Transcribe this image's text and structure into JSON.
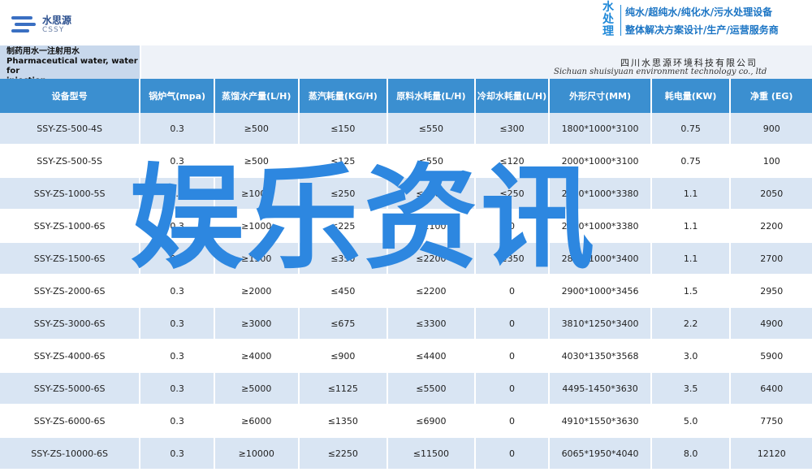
{
  "header": {
    "logo_cn": "水思源",
    "logo_en": "CSSY",
    "brand_vertical": "水处理",
    "tagline_1": "纯水/超纯水/纯化水/污水处理设备",
    "tagline_2": "整体解决方案设计/生产/运营服务商"
  },
  "subheader": {
    "title_cn": "制药用水一注射用水",
    "title_en_1": "Pharmaceutical water, water for",
    "title_en_2": "injection",
    "company_cn": "四川水思源环境科技有限公司",
    "company_en": "Sichuan shuisiyuan environment technology co., ltd"
  },
  "table": {
    "columns": [
      "设备型号",
      "锅炉气(mpa)",
      "蒸馏水产量(L/H)",
      "蒸汽耗量(KG/H)",
      "原料水耗量(L/H)",
      "冷却水耗量(L/H)",
      "外形尺寸(MM)",
      "耗电量(KW)",
      "净重 (EG)"
    ],
    "rows": [
      [
        "SSY-ZS-500-4S",
        "0.3",
        "≥500",
        "≤150",
        "≤550",
        "≤300",
        "1800*1000*3100",
        "0.75",
        "900"
      ],
      [
        "SSY-ZS-500-5S",
        "0.3",
        "≥500",
        "≤125",
        "≤550",
        "≤120",
        "2000*1000*3100",
        "0.75",
        "100"
      ],
      [
        "SSY-ZS-1000-5S",
        "0.3",
        "≥1000",
        "≤250",
        "≤1100",
        "≤250",
        "2200*1000*3380",
        "1.1",
        "2050"
      ],
      [
        "SSY-ZS-1000-6S",
        "0.3",
        "≥1000",
        "≤225",
        "≤1100",
        "0",
        "2450*1000*3380",
        "1.1",
        "2200"
      ],
      [
        "SSY-ZS-1500-6S",
        "0.3",
        "≥1500",
        "≤350",
        "≤2200",
        "≤350",
        "2800*1000*3400",
        "1.1",
        "2700"
      ],
      [
        "SSY-ZS-2000-6S",
        "0.3",
        "≥2000",
        "≤450",
        "≤2200",
        "0",
        "2900*1000*3456",
        "1.5",
        "2950"
      ],
      [
        "SSY-ZS-3000-6S",
        "0.3",
        "≥3000",
        "≤675",
        "≤3300",
        "0",
        "3810*1250*3400",
        "2.2",
        "4900"
      ],
      [
        "SSY-ZS-4000-6S",
        "0.3",
        "≥4000",
        "≤900",
        "≤4400",
        "0",
        "4030*1350*3568",
        "3.0",
        "5900"
      ],
      [
        "SSY-ZS-5000-6S",
        "0.3",
        "≥5000",
        "≤1125",
        "≤5500",
        "0",
        "4495-1450*3630",
        "3.5",
        "6400"
      ],
      [
        "SSY-ZS-6000-6S",
        "0.3",
        "≥6000",
        "≤1350",
        "≤6900",
        "0",
        "4910*1550*3630",
        "5.0",
        "7750"
      ],
      [
        "SSY-ZS-10000-6S",
        "0.3",
        "≥10000",
        "≤2250",
        "≤11500",
        "0",
        "6065*1950*4040",
        "8.0",
        "12120"
      ]
    ]
  },
  "watermark": "娱乐资讯",
  "colors": {
    "header_blue": "#3b8fd0",
    "row_alt": "#d9e5f3",
    "brand": "#1a74c4",
    "watermark": "#2d87e0"
  }
}
